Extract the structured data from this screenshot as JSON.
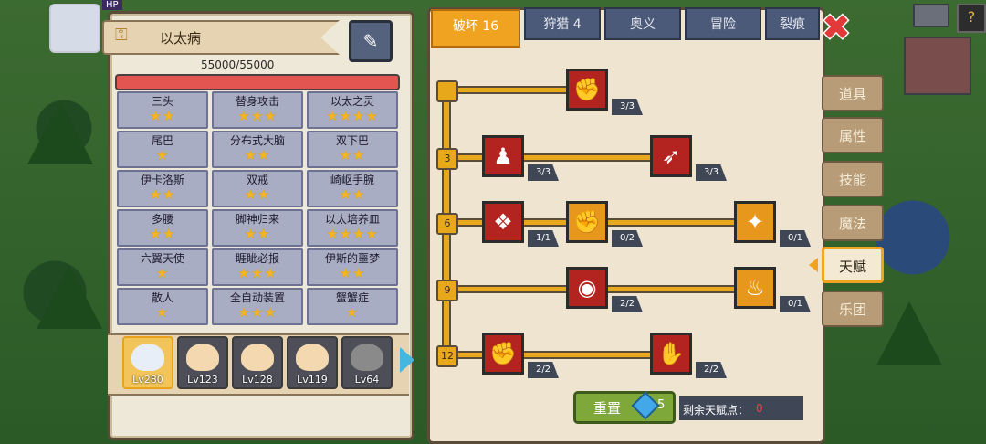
{
  "hud": {
    "level_badge": "HP"
  },
  "panel_title": "以太病",
  "hp_text": "55000/55000",
  "hp_ratio": 1.0,
  "colors": {
    "hp": "#e25550",
    "accent": "#f0a321",
    "star": "#f4b620",
    "close": "#e23a3a"
  },
  "traits": [
    {
      "name": "三头",
      "stars": "★★"
    },
    {
      "name": "替身攻击",
      "stars": "★★★"
    },
    {
      "name": "以太之灵",
      "stars": "★★★★"
    },
    {
      "name": "尾巴",
      "stars": "★"
    },
    {
      "name": "分布式大脑",
      "stars": "★★"
    },
    {
      "name": "双下巴",
      "stars": "★★"
    },
    {
      "name": "伊卡洛斯",
      "stars": "★★"
    },
    {
      "name": "双戒",
      "stars": "★★"
    },
    {
      "name": "崎岖手腕",
      "stars": "★★"
    },
    {
      "name": "多腰",
      "stars": "★★"
    },
    {
      "name": "脚神归来",
      "stars": "★★"
    },
    {
      "name": "以太培养皿",
      "stars": "★★★★"
    },
    {
      "name": "六翼天使",
      "stars": "★"
    },
    {
      "name": "睚眦必报",
      "stars": "★★★"
    },
    {
      "name": "伊斯的噩梦",
      "stars": "★★"
    },
    {
      "name": "散人",
      "stars": "★"
    },
    {
      "name": "全自动装置",
      "stars": "★★★"
    },
    {
      "name": "蟹蟹症",
      "stars": "★"
    }
  ],
  "heroes": [
    {
      "lv": "Lv280"
    },
    {
      "lv": "Lv123"
    },
    {
      "lv": "Lv128"
    },
    {
      "lv": "Lv119"
    },
    {
      "lv": "Lv64"
    }
  ],
  "tabs": [
    "破坏 16",
    "狩猎 4",
    "奥义",
    "冒险",
    "裂痕"
  ],
  "side_tabs": [
    "道具",
    "属性",
    "技能",
    "魔法",
    "天赋",
    "乐团"
  ],
  "tier_labels": [
    "3",
    "6",
    "9",
    "12"
  ],
  "talents": {
    "r0": {
      "icon": "✊",
      "count": "3/3"
    },
    "r1a": {
      "icon": "♟",
      "count": "3/3"
    },
    "r1b": {
      "icon": "➶",
      "count": "3/3"
    },
    "r2a": {
      "icon": "❖",
      "count": "1/1"
    },
    "r2b": {
      "icon": "✊",
      "count": "0/2"
    },
    "r2c": {
      "icon": "✦",
      "count": "0/1"
    },
    "r3a": {
      "icon": "◉",
      "count": "2/2"
    },
    "r3b": {
      "icon": "♨",
      "count": "0/1"
    },
    "r4a": {
      "icon": "✊",
      "count": "2/2"
    },
    "r4b": {
      "icon": "✋",
      "count": "2/2"
    }
  },
  "reset": {
    "label": "重置",
    "cost": "5"
  },
  "remaining": {
    "label": "剩余天赋点：",
    "value": "0"
  },
  "close_glyph": "✖"
}
